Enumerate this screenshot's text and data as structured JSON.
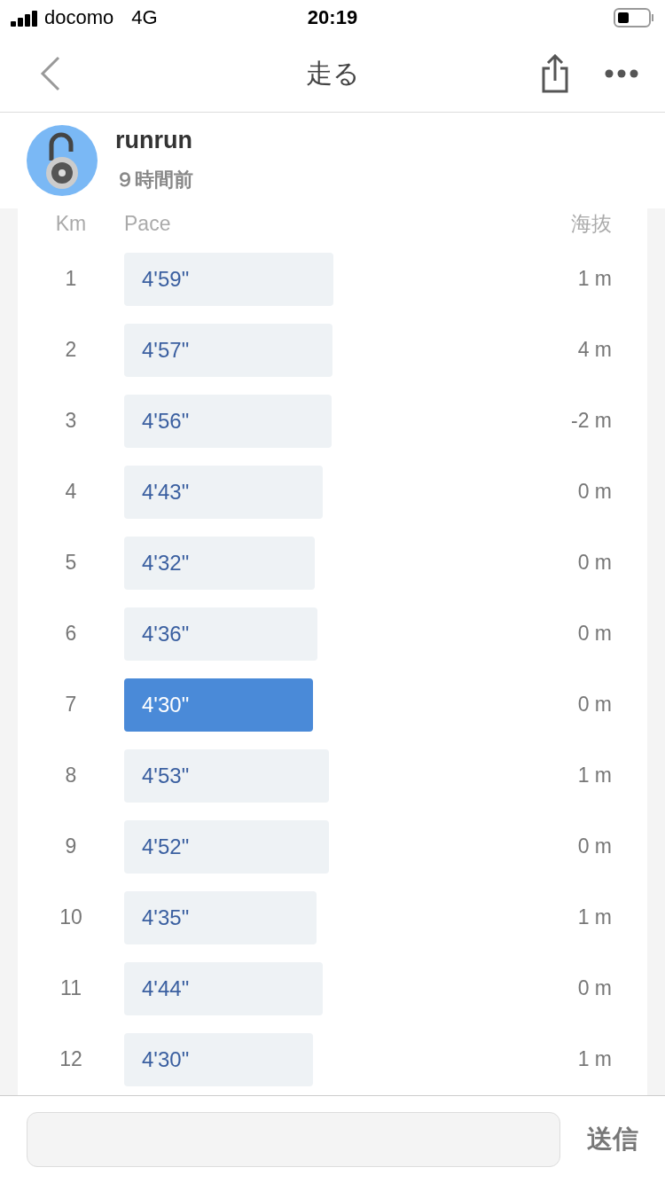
{
  "status_bar": {
    "carrier": "docomo",
    "network": "4G",
    "time": "20:19"
  },
  "nav": {
    "title": "走る"
  },
  "post": {
    "user": "runrun",
    "time": "９時間前"
  },
  "table": {
    "columns": [
      "Km",
      "Pace",
      "海抜"
    ],
    "rows": [
      {
        "km": "1",
        "pace": "4'59\"",
        "selected": false,
        "elevation": "1 m"
      },
      {
        "km": "2",
        "pace": "4'57\"",
        "selected": false,
        "elevation": "4 m"
      },
      {
        "km": "3",
        "pace": "4'56\"",
        "selected": false,
        "elevation": "-2 m"
      },
      {
        "km": "4",
        "pace": "4'43\"",
        "selected": false,
        "elevation": "0 m"
      },
      {
        "km": "5",
        "pace": "4'32\"",
        "selected": false,
        "elevation": "0 m"
      },
      {
        "km": "6",
        "pace": "4'36\"",
        "selected": false,
        "elevation": "0 m"
      },
      {
        "km": "7",
        "pace": "4'30\"",
        "selected": true,
        "elevation": "0 m"
      },
      {
        "km": "8",
        "pace": "4'53\"",
        "selected": false,
        "elevation": "1 m"
      },
      {
        "km": "9",
        "pace": "4'52\"",
        "selected": false,
        "elevation": "0 m"
      },
      {
        "km": "10",
        "pace": "4'35\"",
        "selected": false,
        "elevation": "1 m"
      },
      {
        "km": "11",
        "pace": "4'44\"",
        "selected": false,
        "elevation": "0 m"
      },
      {
        "km": "12",
        "pace": "4'30\"",
        "selected": false,
        "elevation": "1 m"
      }
    ]
  },
  "comment": {
    "send": "送信"
  }
}
